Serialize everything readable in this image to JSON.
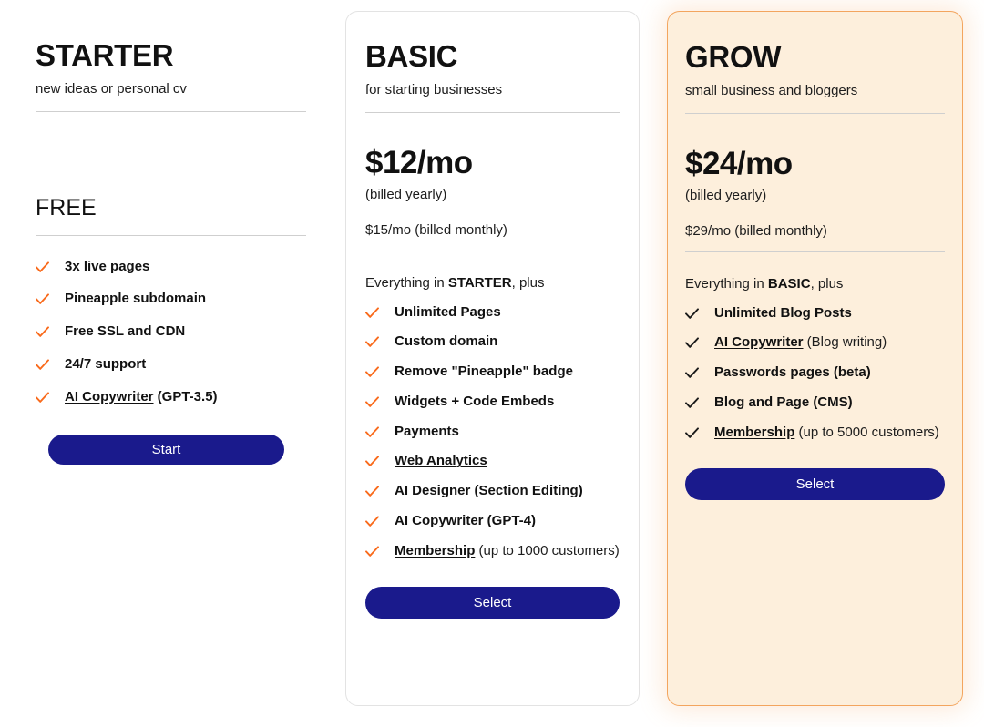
{
  "theme": {
    "accent_orange": "#f96a1b",
    "cta_navy": "#1a1a8c",
    "highlight_bg": "#fdefdc",
    "highlight_border": "#f3a55e",
    "card_border": "#e3e3e3",
    "text_dark": "#111111"
  },
  "plans": {
    "starter": {
      "name": "STARTER",
      "tagline": "new ideas or personal cv",
      "price_label": "FREE",
      "cta_label": "Start",
      "features": [
        {
          "main": "3x live pages",
          "underlined": false,
          "suffix": ""
        },
        {
          "main": "Pineapple subdomain",
          "underlined": false,
          "suffix": ""
        },
        {
          "main": "Free SSL and CDN",
          "underlined": false,
          "suffix": ""
        },
        {
          "main": "24/7 support",
          "underlined": false,
          "suffix": ""
        },
        {
          "main": "AI Copywriter",
          "underlined": true,
          "suffix": " (GPT-3.5)",
          "suffix_bold": true
        }
      ]
    },
    "basic": {
      "name": "BASIC",
      "tagline": "for starting businesses",
      "price_main": "$12/mo",
      "price_sub": "(billed yearly)",
      "price_alt": "$15/mo (billed monthly)",
      "everything_prefix": "Everything in ",
      "everything_plan": "STARTER",
      "everything_suffix": ", plus",
      "cta_label": "Select",
      "features": [
        {
          "main": "Unlimited Pages",
          "underlined": false,
          "suffix": ""
        },
        {
          "main": "Custom domain",
          "underlined": false,
          "suffix": ""
        },
        {
          "main": "Remove \"Pineapple\" badge",
          "underlined": false,
          "suffix": ""
        },
        {
          "main": "Widgets + Code Embeds",
          "underlined": false,
          "suffix": ""
        },
        {
          "main": "Payments",
          "underlined": false,
          "suffix": ""
        },
        {
          "main": "Web Analytics",
          "underlined": true,
          "suffix": ""
        },
        {
          "main": "AI Designer",
          "underlined": true,
          "suffix": " (Section Editing)",
          "suffix_bold": true
        },
        {
          "main": "AI Copywriter",
          "underlined": true,
          "suffix": " (GPT-4)",
          "suffix_bold": true
        },
        {
          "main": "Membership",
          "underlined": true,
          "suffix": " (up to 1000 customers)",
          "suffix_bold": false
        }
      ]
    },
    "grow": {
      "name": "GROW",
      "tagline": "small business and bloggers",
      "price_main": "$24/mo",
      "price_sub": "(billed yearly)",
      "price_alt": "$29/mo (billed monthly)",
      "everything_prefix": "Everything in ",
      "everything_plan": "BASIC",
      "everything_suffix": ", plus",
      "cta_label": "Select",
      "features": [
        {
          "main": "Unlimited Blog Posts",
          "underlined": false,
          "suffix": ""
        },
        {
          "main": "AI Copywriter",
          "underlined": true,
          "suffix": " (Blog writing)",
          "suffix_bold": false
        },
        {
          "main": "Passwords pages (beta)",
          "underlined": false,
          "suffix": ""
        },
        {
          "main": "Blog and Page (CMS)",
          "underlined": false,
          "suffix": ""
        },
        {
          "main": "Membership",
          "underlined": true,
          "suffix": " (up to 5000 customers)",
          "suffix_bold": false
        }
      ]
    }
  }
}
